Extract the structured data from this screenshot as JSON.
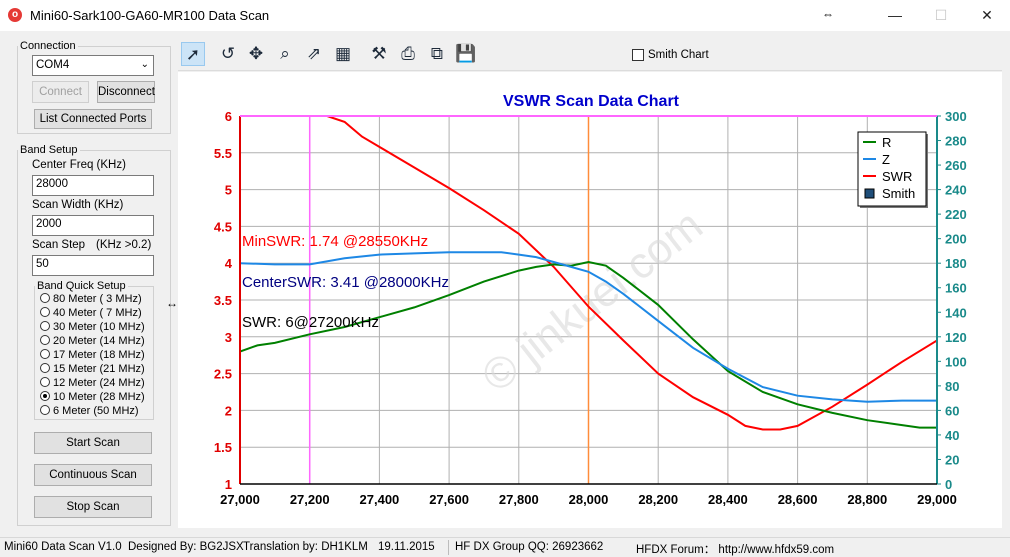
{
  "window": {
    "title": "Mini60-Sark100-GA60-MR100 Data Scan",
    "minimize": "—",
    "maximize": "☐",
    "close": "✕"
  },
  "connection": {
    "legend": "Connection",
    "port": "COM4",
    "connect_label": "Connect",
    "disconnect_label": "Disconnect",
    "list_ports_label": "List Connected Ports"
  },
  "band_setup": {
    "legend": "Band Setup",
    "center_freq_label": "Center Freq  (KHz)",
    "center_freq_value": "28000",
    "scan_width_label": "Scan Width   (KHz)",
    "scan_width_value": "2000",
    "scan_step_label": "Scan Step",
    "scan_step_hint": "(KHz >0.2)",
    "scan_step_value": "50",
    "quick_legend": "Band Quick Setup",
    "quick_bands": [
      {
        "label": "80 Meter (  3 MHz)",
        "selected": false
      },
      {
        "label": "40 Meter (  7 MHz)",
        "selected": false
      },
      {
        "label": "30 Meter (10 MHz)",
        "selected": false
      },
      {
        "label": "20 Meter (14 MHz)",
        "selected": false
      },
      {
        "label": "17 Meter (18 MHz)",
        "selected": false
      },
      {
        "label": "15 Meter (21 MHz)",
        "selected": false
      },
      {
        "label": "12 Meter (24 MHz)",
        "selected": false
      },
      {
        "label": "10 Meter (28 MHz)",
        "selected": true
      },
      {
        "label": "6 Meter   (50 MHz)",
        "selected": false
      }
    ],
    "start_scan_label": "Start Scan",
    "continuous_scan_label": "Continuous Scan",
    "stop_scan_label": "Stop Scan"
  },
  "toolbar": {
    "icons": [
      "pointer-icon",
      "rotate-icon",
      "move-icon",
      "zoom-icon",
      "export-icon",
      "table-icon",
      "settings-icon",
      "print-icon",
      "copy-icon",
      "save-icon"
    ],
    "smith_chart_label": "Smith Chart"
  },
  "chart_data": {
    "type": "line",
    "title": "VSWR Scan Data Chart",
    "x_ticks": [
      "27,000",
      "27,200",
      "27,400",
      "27,600",
      "27,800",
      "28,000",
      "28,200",
      "28,400",
      "28,600",
      "28,800",
      "29,000"
    ],
    "xlim": [
      27000,
      29000
    ],
    "y_left_ticks": [
      "1",
      "1.5",
      "2",
      "2.5",
      "3",
      "3.5",
      "4",
      "4.5",
      "5",
      "5.5",
      "6"
    ],
    "ylim_left": [
      1,
      6
    ],
    "y_right_ticks": [
      "0",
      "20",
      "40",
      "60",
      "80",
      "100",
      "120",
      "140",
      "160",
      "180",
      "200",
      "220",
      "240",
      "260",
      "280",
      "300"
    ],
    "ylim_right": [
      0,
      300
    ],
    "grid": true,
    "legend_position": "top-right",
    "legend": [
      {
        "name": "R",
        "color": "#008000",
        "kind": "line"
      },
      {
        "name": "Z",
        "color": "#1e88e5",
        "kind": "line"
      },
      {
        "name": "SWR",
        "color": "#ff0000",
        "kind": "line"
      },
      {
        "name": "Smith",
        "color": "#1f4e79",
        "kind": "box"
      }
    ],
    "series": [
      {
        "name": "SWR",
        "axis": "left",
        "color": "#ff0000",
        "x": [
          27000,
          27200,
          27250,
          27300,
          27350,
          27400,
          27500,
          27600,
          27700,
          27800,
          27900,
          28000,
          28100,
          28200,
          28300,
          28400,
          28450,
          28500,
          28550,
          28600,
          28700,
          28800,
          28900,
          29000
        ],
        "y": [
          6.9,
          6.4,
          6.0,
          5.92,
          5.72,
          5.58,
          5.3,
          5.02,
          4.72,
          4.4,
          3.95,
          3.41,
          2.95,
          2.5,
          2.18,
          1.94,
          1.79,
          1.74,
          1.74,
          1.79,
          2.05,
          2.35,
          2.66,
          2.95
        ]
      },
      {
        "name": "R",
        "axis": "right",
        "color": "#008000",
        "x": [
          27000,
          27050,
          27100,
          27200,
          27300,
          27400,
          27500,
          27600,
          27700,
          27800,
          27850,
          27900,
          27950,
          28000,
          28050,
          28100,
          28200,
          28300,
          28400,
          28500,
          28600,
          28700,
          28800,
          28900,
          28950,
          29000
        ],
        "y": [
          108,
          113,
          115,
          122,
          128,
          136,
          144,
          154,
          165,
          174,
          177,
          179,
          178,
          181,
          178,
          168,
          146,
          118,
          92,
          75,
          65,
          58,
          52,
          48,
          46,
          46
        ]
      },
      {
        "name": "Z",
        "axis": "right",
        "color": "#1e88e5",
        "x": [
          27000,
          27100,
          27200,
          27300,
          27400,
          27500,
          27600,
          27700,
          27750,
          27800,
          27850,
          27900,
          28000,
          28050,
          28100,
          28200,
          28300,
          28400,
          28500,
          28600,
          28700,
          28800,
          28900,
          29000
        ],
        "y": [
          180,
          179,
          179,
          184,
          187,
          188,
          189,
          189,
          189,
          187,
          185,
          181,
          173,
          165,
          155,
          133,
          111,
          94,
          79,
          72,
          69,
          67,
          68,
          68
        ]
      }
    ],
    "markers": [
      {
        "x": 27200,
        "color": "#ff66ff"
      },
      {
        "x": 28000,
        "color": "#ff8c3a"
      }
    ],
    "annotations": [
      {
        "text": "MinSWR: 1.74 @28550KHz",
        "color": "#ff0000"
      },
      {
        "text": "CenterSWR: 3.41 @28000KHz",
        "color": "#000080"
      },
      {
        "text": "SWR: 6@27200KHz",
        "color": "#000000"
      }
    ],
    "watermark": "© jinkuei.com"
  },
  "status": {
    "version": "Mini60 Data Scan V1.0",
    "designer": "Designed By: BG2JSX",
    "translation": "Translation by: DH1KLM",
    "date": "19.11.2015",
    "group": "HF DX Group QQ: 26923662",
    "forum": "HFDX Forum：  http://www.hfdx59.com"
  }
}
